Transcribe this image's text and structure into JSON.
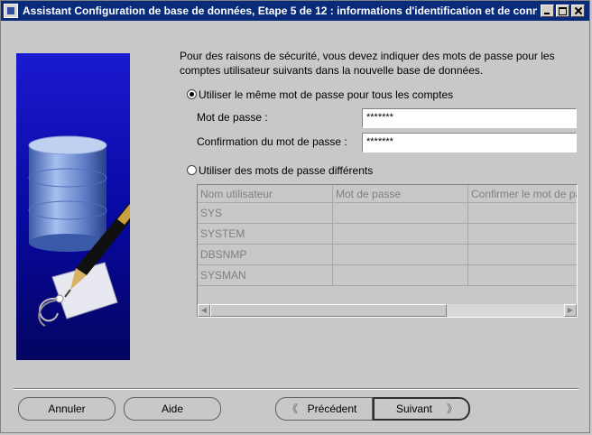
{
  "window": {
    "title": "Assistant Configuration de base de données, Etape 5 de 12 : informations d'identification et de connexion"
  },
  "intro_text": "Pour des raisons de sécurité, vous devez indiquer des mots de passe pour les comptes utilisateur suivants dans la nouvelle base de données.",
  "same_password": {
    "label": "Utiliser le même mot de passe pour tous les comptes",
    "selected": true,
    "password_label": "Mot de passe :",
    "password_value": "*******",
    "confirm_label": "Confirmation du mot de passe :",
    "confirm_value": "*******"
  },
  "different_passwords": {
    "label": "Utiliser des mots de passe différents",
    "selected": false,
    "columns": [
      "Nom utilisateur",
      "Mot de passe",
      "Confirmer le mot de passe"
    ],
    "rows": [
      [
        "SYS",
        "",
        ""
      ],
      [
        "SYSTEM",
        "",
        ""
      ],
      [
        "DBSNMP",
        "",
        ""
      ],
      [
        "SYSMAN",
        "",
        ""
      ]
    ]
  },
  "buttons": {
    "cancel": "Annuler",
    "help": "Aide",
    "back": "Précédent",
    "next": "Suivant"
  },
  "colors": {
    "titlebar": "#0a2a7a",
    "background": "#c8c8c8",
    "side_image": "#0808a0"
  }
}
